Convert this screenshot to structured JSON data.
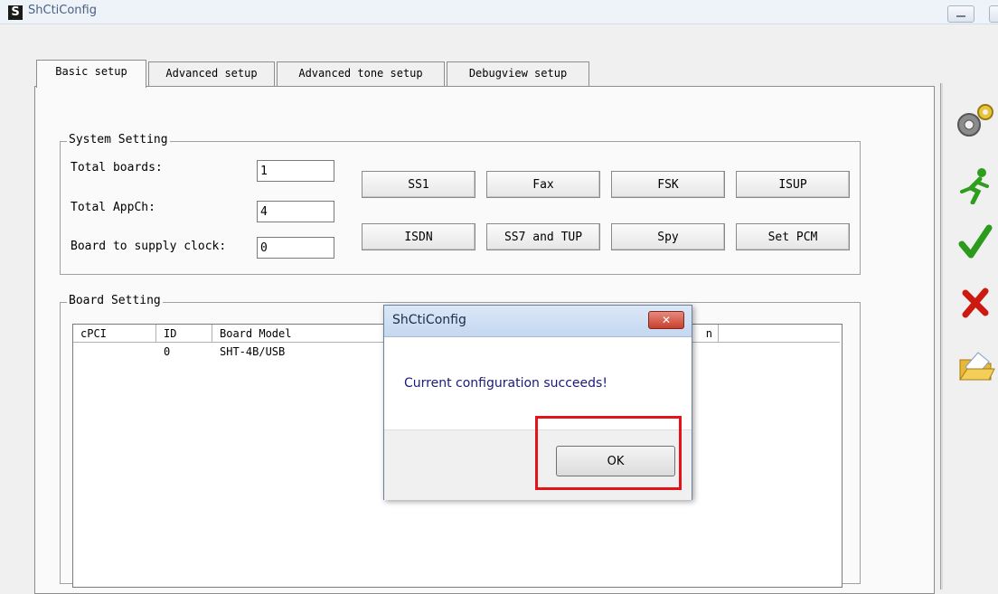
{
  "window": {
    "title": "ShCtiConfig",
    "logo_letter": "S"
  },
  "tabs": [
    {
      "label": "Basic setup",
      "active": true
    },
    {
      "label": "Advanced setup",
      "active": false
    },
    {
      "label": "Advanced tone setup",
      "active": false
    },
    {
      "label": "Debugview setup",
      "active": false
    }
  ],
  "system_setting": {
    "group_label": "System Setting",
    "fields": [
      {
        "label": "Total boards:",
        "value": "1"
      },
      {
        "label": "Total AppCh:",
        "value": "4"
      },
      {
        "label": "Board to supply clock:",
        "value": "0"
      }
    ],
    "buttons": [
      "SS1",
      "Fax",
      "FSK",
      "ISUP",
      "ISDN",
      "SS7 and TUP",
      "Spy",
      "Set PCM"
    ]
  },
  "board_setting": {
    "group_label": "Board Setting",
    "columns": [
      "cPCI",
      "ID",
      "Board Model",
      "n"
    ],
    "rows": [
      {
        "cpci": "",
        "id": "0",
        "model": "SHT-4B/USB"
      }
    ]
  },
  "right_toolbar": {
    "icons": [
      "gears-icon",
      "running-man-icon",
      "checkmark-icon",
      "red-x-icon",
      "open-folder-icon"
    ]
  },
  "dialog": {
    "title": "ShCtiConfig",
    "close_glyph": "✕",
    "message": "Current configuration succeeds!",
    "ok_label": "OK"
  },
  "colors": {
    "highlight": "#e2141a",
    "dialog_text": "#1a1a7a",
    "title_text": "#4a5f82"
  }
}
